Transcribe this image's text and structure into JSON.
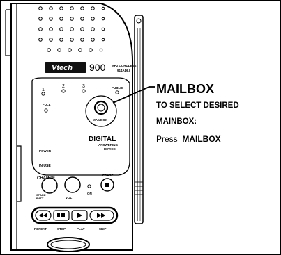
{
  "brand": {
    "logo_text": "Vtech",
    "model_number": "900",
    "model_line1": "MHz CORDLESS",
    "model_line2": "914ADLI"
  },
  "indicators": {
    "box1": "1",
    "box2": "2",
    "box3": "3",
    "public": "PUBLIC",
    "full": "FULL",
    "power": "POWER",
    "in_use": "IN USE",
    "charge": "CHARGE",
    "spare_batt_1": "SPARE",
    "spare_batt_2": "BATT",
    "on": "ON"
  },
  "device_title": {
    "line1": "DIGITAL",
    "line2": "ANSWERING",
    "line3": "DEVICE"
  },
  "controls": {
    "mailbox_button": "MAILBOX",
    "erase": "ERASE",
    "vol": "VOL",
    "repeat": "REPEAT",
    "stop": "STOP",
    "play": "PLAY",
    "skip": "SKIP"
  },
  "callout": {
    "heading": "MAILBOX",
    "subheading_line1": "TO SELECT DESIRED",
    "subheading_line2": "MAINBOX:",
    "instruction_prefix": "Press",
    "instruction_key": "MAILBOX"
  },
  "colors": {
    "ink": "#000000",
    "paper": "#ffffff",
    "logo_fill": "#111111"
  }
}
